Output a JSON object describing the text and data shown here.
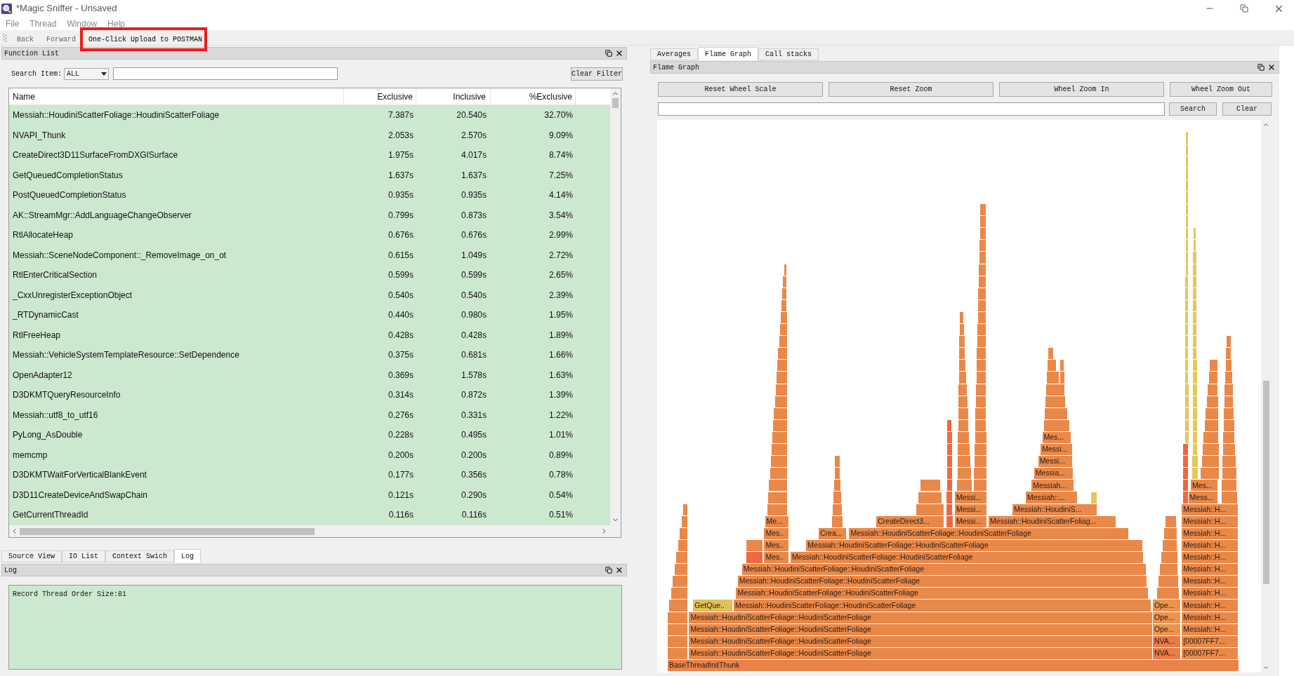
{
  "window": {
    "title": "*Magic Sniffer - Unsaved"
  },
  "menu": [
    "File",
    "Thread",
    "Window",
    "Help"
  ],
  "toolbar": [
    {
      "label": "Back",
      "highlighted": false
    },
    {
      "label": "Forward",
      "highlighted": false
    },
    {
      "label": "One-Click Upload to POSTMAN",
      "highlighted": true
    }
  ],
  "function_list": {
    "title": "Function List",
    "search_label": "Search Item:",
    "search_scope": "ALL",
    "clear_button": "Clear Filter",
    "columns": [
      "Name",
      "Exclusive",
      "Inclusive",
      "%Exclusive"
    ],
    "rows": [
      [
        "Messiah::HoudiniScatterFoliage::HoudiniScatterFoliage",
        "7.387s",
        "20.540s",
        "32.70%"
      ],
      [
        "NVAPI_Thunk",
        "2.053s",
        "2.570s",
        "9.09%"
      ],
      [
        "CreateDirect3D11SurfaceFromDXGISurface",
        "1.975s",
        "4.017s",
        "8.74%"
      ],
      [
        "GetQueuedCompletionStatus",
        "1.637s",
        "1.637s",
        "7.25%"
      ],
      [
        "PostQueuedCompletionStatus",
        "0.935s",
        "0.935s",
        "4.14%"
      ],
      [
        "AK::StreamMgr::AddLanguageChangeObserver",
        "0.799s",
        "0.873s",
        "3.54%"
      ],
      [
        "RtlAllocateHeap",
        "0.676s",
        "0.676s",
        "2.99%"
      ],
      [
        "Messiah::SceneNodeComponent::_RemoveImage_on_ot",
        "0.615s",
        "1.049s",
        "2.72%"
      ],
      [
        "RtlEnterCriticalSection",
        "0.599s",
        "0.599s",
        "2.65%"
      ],
      [
        "_CxxUnregisterExceptionObject",
        "0.540s",
        "0.540s",
        "2.39%"
      ],
      [
        "_RTDynamicCast",
        "0.440s",
        "0.980s",
        "1.95%"
      ],
      [
        "RtlFreeHeap",
        "0.428s",
        "0.428s",
        "1.89%"
      ],
      [
        "Messiah::VehicleSystemTemplateResource::SetDependence",
        "0.375s",
        "0.681s",
        "1.66%"
      ],
      [
        "OpenAdapter12",
        "0.369s",
        "1.578s",
        "1.63%"
      ],
      [
        "D3DKMTQueryResourceInfo",
        "0.314s",
        "0.872s",
        "1.39%"
      ],
      [
        "Messiah::utf8_to_utf16",
        "0.276s",
        "0.331s",
        "1.22%"
      ],
      [
        "PyLong_AsDouble",
        "0.228s",
        "0.495s",
        "1.01%"
      ],
      [
        "memcmp",
        "0.200s",
        "0.200s",
        "0.89%"
      ],
      [
        "D3DKMTWaitForVerticalBlankEvent",
        "0.177s",
        "0.356s",
        "0.78%"
      ],
      [
        "D3D11CreateDeviceAndSwapChain",
        "0.121s",
        "0.290s",
        "0.54%"
      ],
      [
        "GetCurrentThreadId",
        "0.116s",
        "0.116s",
        "0.51%"
      ]
    ]
  },
  "bottom_tabs": [
    {
      "label": "Source View",
      "selected": false
    },
    {
      "label": "IO List",
      "selected": false
    },
    {
      "label": "Context Swich",
      "selected": false
    },
    {
      "label": "Log",
      "selected": true
    }
  ],
  "log": {
    "title": "Log",
    "lines": [
      "Record Thread Order Size:81"
    ]
  },
  "right_tabs": [
    {
      "label": "Averages",
      "selected": false
    },
    {
      "label": "Flame Graph",
      "selected": true
    },
    {
      "label": "Call stacks",
      "selected": false
    }
  ],
  "flame_graph": {
    "title": "Flame Graph",
    "buttons": [
      "Reset Wheel Scale",
      "Reset Zoom",
      "Wheel Zoom In",
      "Wheel Zoom Out"
    ],
    "search_button": "Search",
    "clear_button": "Clear",
    "frames": [
      {
        "label": "Mes...",
        "color": "#e8894a"
      },
      {
        "label": "Messi...",
        "color": "#e8894a"
      },
      {
        "label": "Messi...",
        "color": "#e8894a"
      },
      {
        "label": "Messia...",
        "color": "#e8894a"
      },
      {
        "label": "Messiah...",
        "color": "#e8894a"
      },
      {
        "label": "Mes...",
        "color": "#e8894a"
      },
      {
        "label": "Messi...",
        "color": "#e8894a"
      },
      {
        "label": "Messiah::...",
        "color": "#e8894a"
      },
      {
        "label": "Mess...",
        "color": "#e8894a"
      },
      {
        "label": "Messi...",
        "color": "#e8894a"
      },
      {
        "label": "Messiah::HoudiniS...",
        "color": "#e8894a"
      },
      {
        "label": "Messiah::H...",
        "color": "#e8894a"
      },
      {
        "label": "Me...",
        "color": "#e8894a"
      },
      {
        "label": "CreateDirect3...",
        "color": "#e8894a"
      },
      {
        "label": "Messi...",
        "color": "#e8894a"
      },
      {
        "label": "Messiah::HoudiniScatterFoliag...",
        "color": "#e8894a"
      },
      {
        "label": "Messiah::H...",
        "color": "#e8894a"
      },
      {
        "label": "Mes..",
        "color": "#e8894a"
      },
      {
        "label": "Crea...",
        "color": "#e8894a"
      },
      {
        "label": "Messiah::HoudiniScatterFoliage::HoudiniScatterFoliage",
        "color": "#e8894a"
      },
      {
        "label": "Messiah::H...",
        "color": "#e8894a"
      },
      {
        "label": "Mes..",
        "color": "#e8894a"
      },
      {
        "label": "Messiah::HoudiniScatterFoliage::HoudiniScatterFoliage",
        "color": "#e8894a"
      },
      {
        "label": "Messiah::H...",
        "color": "#e8894a"
      },
      {
        "label": "Mes..",
        "color": "#e8894a"
      },
      {
        "label": "Messiah::HoudiniScatterFoliage::HoudiniScatterFoliage",
        "color": "#e8894a"
      },
      {
        "label": "Messiah::H...",
        "color": "#e8894a"
      },
      {
        "label": "Messiah::HoudiniScatterFoliage::HoudiniScatterFoliage",
        "color": "#e8894a"
      },
      {
        "label": "Messiah::H...",
        "color": "#e8894a"
      },
      {
        "label": "Messiah::HoudiniScatterFoliage::HoudiniScatterFoliage",
        "color": "#e8894a"
      },
      {
        "label": "Messiah::H...",
        "color": "#e8894a"
      },
      {
        "label": "Messiah::HoudiniScatterFoliage::HoudiniScatterFoliage",
        "color": "#e8894a"
      },
      {
        "label": "Messiah::H...",
        "color": "#e8894a"
      },
      {
        "label": "GetQue..",
        "color": "#e1c05a"
      },
      {
        "label": "Messiah::HoudiniScatterFoliage::HoudiniScatterFoliage",
        "color": "#e8894a"
      },
      {
        "label": "Ope...",
        "color": "#ea9450"
      },
      {
        "label": "Messiah::H...",
        "color": "#e8894a"
      },
      {
        "label": "Messiah::HoudiniScatterFoliage::HoudiniScatterFoliage",
        "color": "#e8894a"
      },
      {
        "label": "Ope...",
        "color": "#ea9450"
      },
      {
        "label": "Messiah::H...",
        "color": "#e8894a"
      },
      {
        "label": "Messiah::HoudiniScatterFoliage::HoudiniScatterFoliage",
        "color": "#e8894a"
      },
      {
        "label": "Ope...",
        "color": "#ea9450"
      },
      {
        "label": "Messiah::H...",
        "color": "#e8894a"
      },
      {
        "label": "Messiah::HoudiniScatterFoliage::HoudiniScatterFoliage",
        "color": "#e8894a"
      },
      {
        "label": "NVA...",
        "color": "#ea7c48"
      },
      {
        "label": "[00007FF7...",
        "color": "#e8894a"
      },
      {
        "label": "Messiah::HoudiniScatterFoliage::HoudiniScatterFoliage",
        "color": "#e8894a"
      },
      {
        "label": "NVA...",
        "color": "#ea7c48"
      },
      {
        "label": "[00007FF7...",
        "color": "#e8894a"
      },
      {
        "label": "BaseThreadInitThunk",
        "color": "#e8834a"
      }
    ]
  }
}
